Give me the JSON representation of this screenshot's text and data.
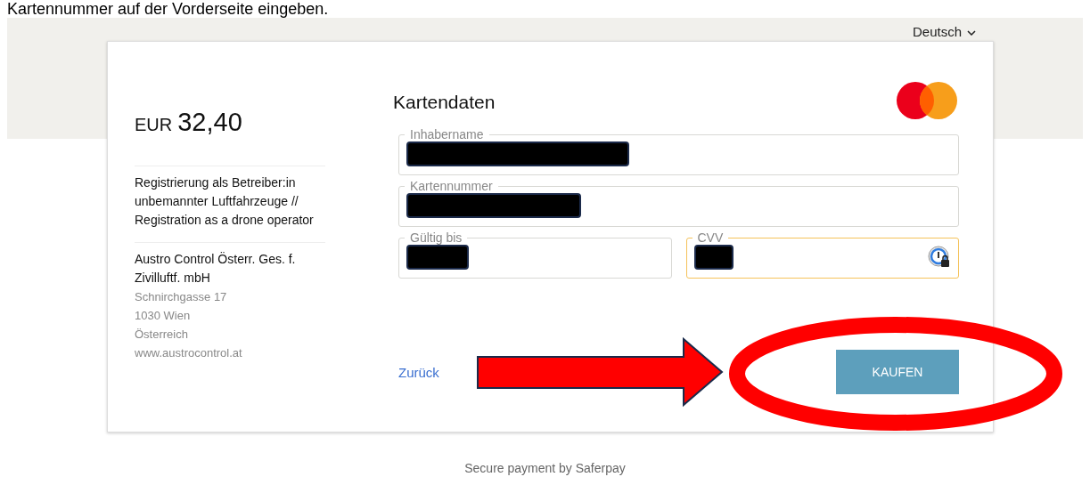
{
  "caption": "Kartennummer auf der Vorderseite eingeben.",
  "language": {
    "label": "Deutsch"
  },
  "summary": {
    "currency": "EUR",
    "amount": "32,40",
    "description": "Registrierung als Betreiber:in unbemannter Luftfahrzeuge // Registration as a drone operator",
    "merchant": {
      "name": "Austro Control Österr. Ges. f. Zivilluftf. mbH",
      "address": [
        "Schnirchgasse 17",
        "1030 Wien",
        "Österreich",
        "www.austrocontrol.at"
      ]
    }
  },
  "form": {
    "title": "Kartendaten",
    "fields": [
      {
        "label": "Inhabername",
        "focused": false,
        "redacted": true,
        "password_manager": false
      },
      {
        "label": "Kartennummer",
        "focused": false,
        "redacted": true,
        "password_manager": false
      },
      {
        "label": "Gültig bis",
        "focused": false,
        "redacted": true,
        "password_manager": false
      },
      {
        "label": "CVV",
        "focused": true,
        "redacted": true,
        "password_manager": true
      }
    ],
    "back": "Zurück",
    "submit": "KAUFEN"
  },
  "footer": "Secure payment by Saferpay"
}
